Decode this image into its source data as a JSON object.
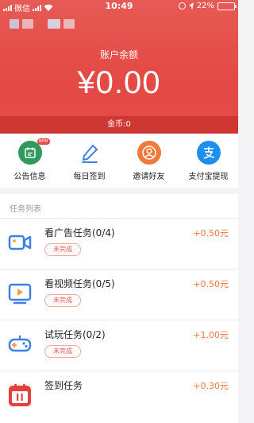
{
  "status_bar": {
    "carrier": "微信",
    "time": "10:49",
    "battery_percent": "22%",
    "battery_level": 0.22
  },
  "balance": {
    "title": "账户余额",
    "amount": "¥0.00",
    "coins": "金币:0"
  },
  "quick_actions": [
    {
      "label": "公告信息",
      "icon": "announcement-icon",
      "badge": "NEW",
      "color": "#2f9a5c"
    },
    {
      "label": "每日签到",
      "icon": "pen-icon",
      "color": "#3b82e6"
    },
    {
      "label": "邀请好友",
      "icon": "user-icon",
      "color": "#f07a3a"
    },
    {
      "label": "支付宝提现",
      "icon": "alipay-icon",
      "color": "#1f8fee"
    }
  ],
  "tasks": {
    "section_title": "任务列表",
    "items": [
      {
        "name": "看广告任务(0/4)",
        "status": "未完成",
        "reward": "+0.50元",
        "icon": "video-camera-icon"
      },
      {
        "name": "看视频任务(0/5)",
        "status": "未完成",
        "reward": "+0.50元",
        "icon": "tv-play-icon"
      },
      {
        "name": "试玩任务(0/2)",
        "status": "未完成",
        "reward": "+1.00元",
        "icon": "gamepad-icon"
      },
      {
        "name": "签到任务",
        "status": "",
        "reward": "+0.30元",
        "icon": "calendar-icon"
      }
    ]
  },
  "colors": {
    "header": "#e44a46",
    "reward": "#f0773a",
    "status_pending": "#e4554c"
  }
}
